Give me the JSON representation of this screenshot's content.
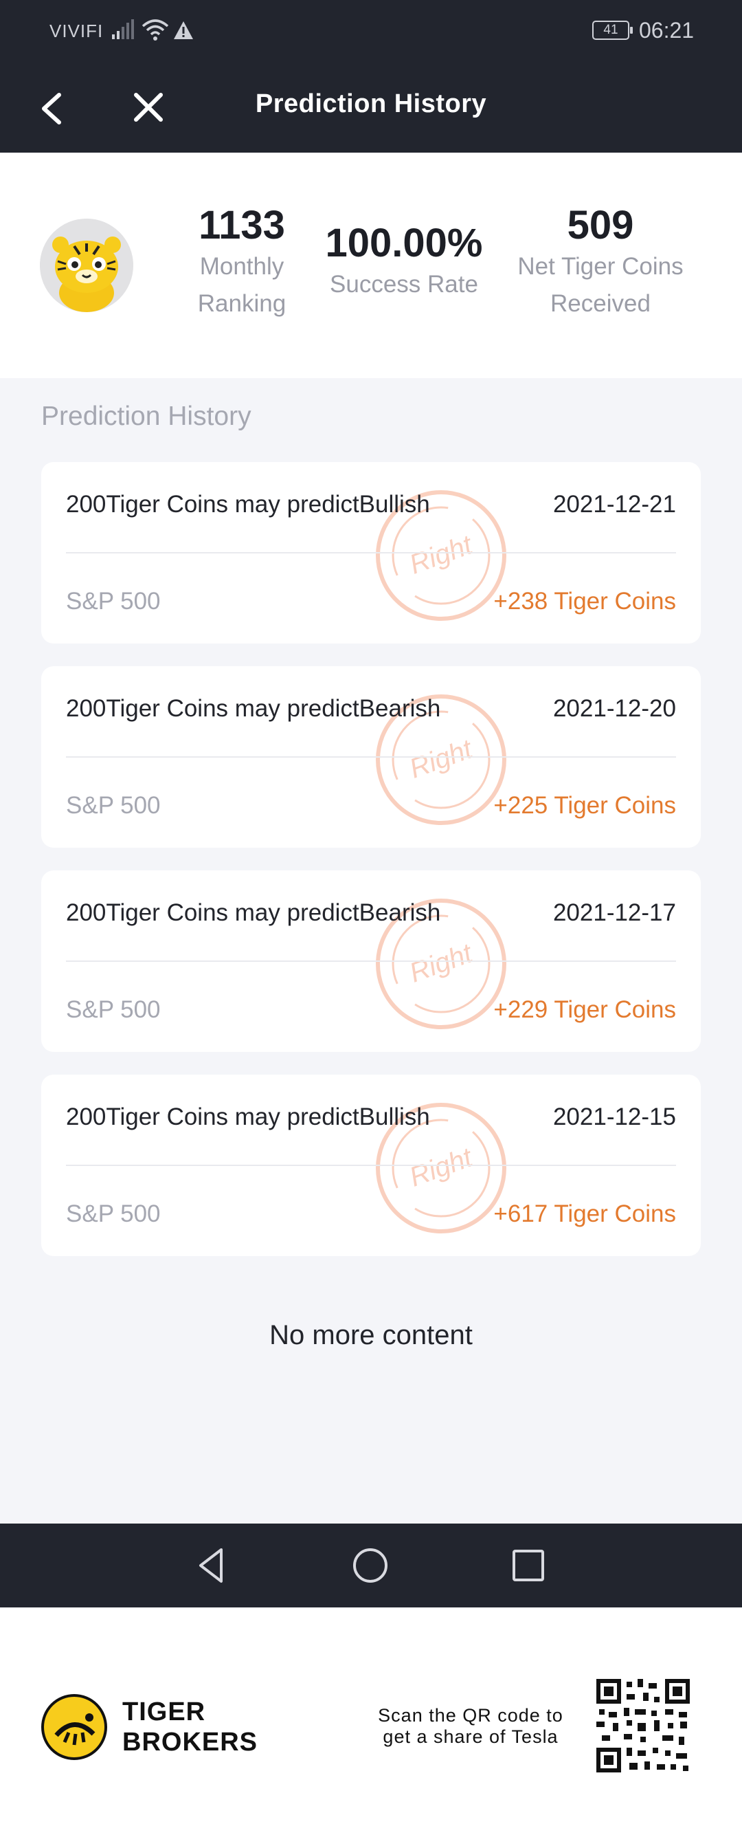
{
  "status_bar": {
    "carrier": "VIVIFI",
    "battery": "41",
    "time": "06:21"
  },
  "header": {
    "title": "Prediction History",
    "back_icon": "chevron-left-icon",
    "close_icon": "close-icon"
  },
  "stats": {
    "ranking": {
      "value": "1133",
      "label_line1": "Monthly",
      "label_line2": "Ranking"
    },
    "success": {
      "value": "100.00%",
      "label": "Success Rate"
    },
    "coins": {
      "value": "509",
      "label_line1": "Net Tiger Coins",
      "label_line2": "Received"
    }
  },
  "section_title": "Prediction History",
  "predictions": [
    {
      "prediction": "200Tiger Coins may predictBullish",
      "date": "2021-12-21",
      "market": "S&P 500",
      "gain": "+238 Tiger Coins",
      "stamp": "Right"
    },
    {
      "prediction": "200Tiger Coins may predictBearish",
      "date": "2021-12-20",
      "market": "S&P 500",
      "gain": "+225 Tiger Coins",
      "stamp": "Right"
    },
    {
      "prediction": "200Tiger Coins may predictBearish",
      "date": "2021-12-17",
      "market": "S&P 500",
      "gain": "+229 Tiger Coins",
      "stamp": "Right"
    },
    {
      "prediction": "200Tiger Coins may predictBullish",
      "date": "2021-12-15",
      "market": "S&P 500",
      "gain": "+617 Tiger Coins",
      "stamp": "Right"
    }
  ],
  "no_more": "No more content",
  "footer": {
    "brand_line1": "TIGER",
    "brand_line2": "BROKERS",
    "qr_line1": "Scan the QR code to",
    "qr_line2": "get a share of Tesla"
  },
  "colors": {
    "header_bg": "#22252e",
    "accent_gain": "#e37a2e",
    "stamp": "#f28a5e",
    "muted_text": "#a5a7b1"
  }
}
